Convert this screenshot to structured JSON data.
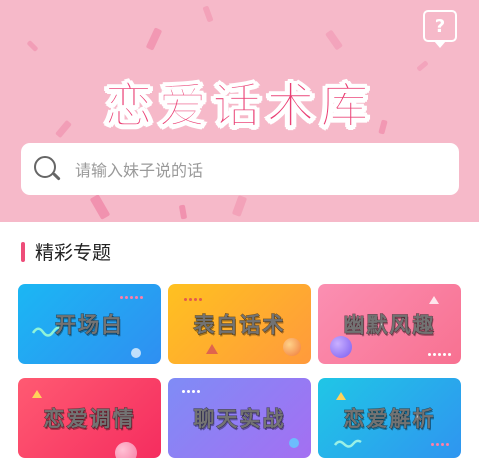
{
  "header": {
    "title": "恋爱话术库",
    "help_icon": "help-question-icon",
    "help_glyph": "?",
    "background_color": "#f6b9c9",
    "title_color": "#ea3f74"
  },
  "search": {
    "placeholder": "请输入妹子说的话",
    "icon": "search-icon"
  },
  "section": {
    "title": "精彩专题",
    "accent_color": "#ee4d79"
  },
  "topics": [
    {
      "label": "开场白",
      "gradient": [
        "#1bb7f3",
        "#2f8ff2"
      ]
    },
    {
      "label": "表白话术",
      "gradient": [
        "#ffc120",
        "#ff9a3c"
      ]
    },
    {
      "label": "幽默风趣",
      "gradient": [
        "#fb8fb2",
        "#f87191"
      ]
    },
    {
      "label": "恋爱调情",
      "gradient": [
        "#ff5a72",
        "#f52d5f"
      ]
    },
    {
      "label": "聊天实战",
      "gradient": [
        "#7f8cf6",
        "#a46ff2"
      ]
    },
    {
      "label": "恋爱解析",
      "gradient": [
        "#20c6e6",
        "#2f95f0"
      ]
    }
  ]
}
